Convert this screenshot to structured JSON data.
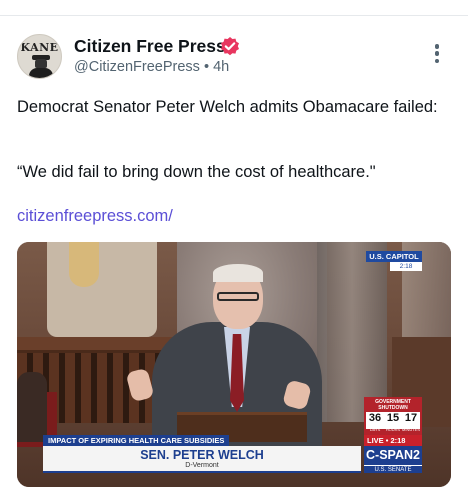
{
  "post": {
    "author": {
      "name": "Citizen Free Press",
      "handle": "@CitizenFreePress",
      "separator": "•",
      "time": "4h",
      "avatar_text": "KANE",
      "verified_color": "#e8365f"
    },
    "text": "Democrat Senator Peter Welch admits Obamacare failed:",
    "quote": "“We did fail to bring down the cost of healthcare.\"",
    "link": "citizenfreepress.com/",
    "link_color": "#5b4fd6"
  },
  "media": {
    "location_badge": "U.S. CAPITOL",
    "badge_time": "2:18",
    "shutdown": {
      "label_line1": "GOVERNMENT",
      "label_line2": "SHUTDOWN",
      "days": "36",
      "hours": "15",
      "minutes": "17",
      "days_label": "DAYS",
      "hours_label": "HOURS",
      "minutes_label": "MINUTES"
    },
    "lower_third": {
      "topic": "IMPACT OF EXPIRING HEALTH CARE SUBSIDIES",
      "name": "SEN. PETER WELCH",
      "party": "D-Vermont"
    },
    "network": {
      "live_text": "LIVE • 2:18",
      "name": "C-SPAN2",
      "chamber": "U.S. SENATE"
    }
  }
}
